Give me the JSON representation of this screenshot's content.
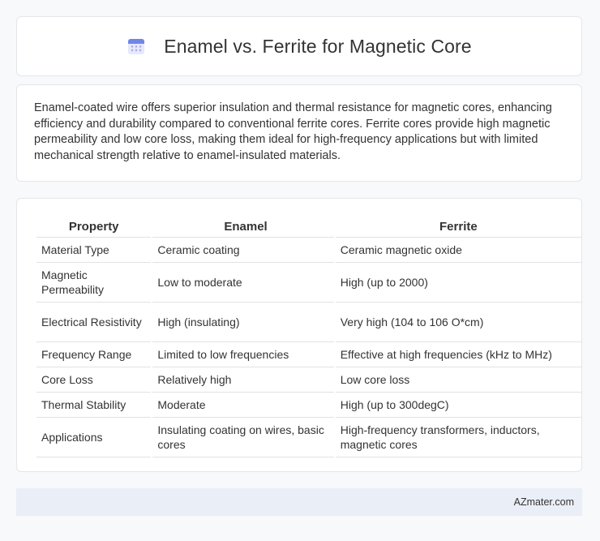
{
  "header": {
    "title": "Enamel vs. Ferrite for Magnetic Core",
    "icon": "calendar-icon"
  },
  "intro": {
    "text": "Enamel-coated wire offers superior insulation and thermal resistance for magnetic cores, enhancing efficiency and durability compared to conventional ferrite cores. Ferrite cores provide high magnetic permeability and low core loss, making them ideal for high-frequency applications but with limited mechanical strength relative to enamel-insulated materials."
  },
  "table": {
    "headers": [
      "Property",
      "Enamel",
      "Ferrite"
    ],
    "rows": [
      [
        "Material Type",
        "Ceramic coating",
        "Ceramic magnetic oxide"
      ],
      [
        "Magnetic Permeability",
        "Low to moderate",
        "High (up to 2000)"
      ],
      [
        "Electrical Resistivity",
        "High (insulating)",
        "Very high (104 to 106 O*cm)"
      ],
      [
        "Frequency Range",
        "Limited to low frequencies",
        "Effective at high frequencies (kHz to MHz)"
      ],
      [
        "Core Loss",
        "Relatively high",
        "Low core loss"
      ],
      [
        "Thermal Stability",
        "Moderate",
        "High (up to 300degC)"
      ],
      [
        "Applications",
        "Insulating coating on wires, basic cores",
        "High-frequency transformers, inductors, magnetic cores"
      ]
    ]
  },
  "footer": {
    "brand": "AZmater.com"
  }
}
